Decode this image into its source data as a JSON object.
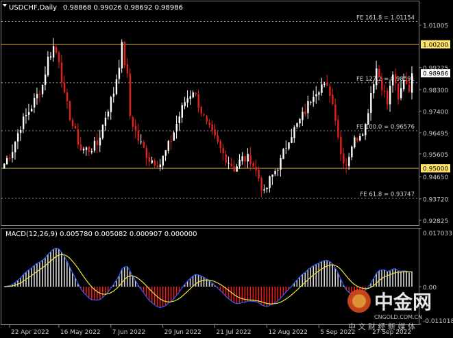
{
  "header": {
    "symbol": "USDCHF,Daily",
    "ohlc": "0.98868 0.99026 0.98692 0.98986"
  },
  "macd_header": {
    "label": "MACD(12,26,9) 0.005780 0.005082 0.000907 0.000000"
  },
  "watermark": {
    "logo_text": "中金网",
    "site": "CNGOLD.COM.CN",
    "tagline": "中 文 财 经 新 媒 体"
  },
  "colors": {
    "background": "#000000",
    "grid": "#3a3a3a",
    "axis_text": "#c8c8c8",
    "bull_candle": "#ffffff",
    "bear_candle": "#e8201c",
    "fib_line": "#a0a0a0",
    "horizontal_line": "#e0b84a",
    "macd_line": "#2d5bff",
    "signal_line": "#f2e43a",
    "hist_pos": "#d8d8d8",
    "hist_neg": "#e8201c",
    "current_price_bg": "#ffffff"
  },
  "chart_data": [
    {
      "type": "candlestick",
      "title": "USDCHF,Daily",
      "ylim": [
        0.9262,
        1.02
      ],
      "price_ticks": [
        "1.01005",
        "0.99225",
        "0.98300",
        "0.97400",
        "0.96495",
        "0.95605",
        "0.94650",
        "0.93720",
        "0.92825"
      ],
      "x_ticks": [
        "22 Apr 2022",
        "16 May 2022",
        "7 Jun 2022",
        "29 Jun 2022",
        "21 Jul 2022",
        "12 Aug 2022",
        "5 Sep 2022",
        "27 Sep 2022"
      ],
      "fibonacci_levels": [
        {
          "label": "FE 161.8 = 1.01154",
          "value": 1.01154
        },
        {
          "label": "FE 127.2 = 0.98591",
          "value": 0.98591
        },
        {
          "label": "FE 100.0 = 0.96576",
          "value": 0.96576
        },
        {
          "label": "FE 61.8 = 0.93747",
          "value": 0.93747
        }
      ],
      "horizontal_lines": [
        {
          "label": "1.00200",
          "value": 1.002
        },
        {
          "label": "0.95000",
          "value": 0.95
        }
      ],
      "current_price": {
        "label": "0.98986",
        "value": 0.98986
      },
      "anchors": [
        [
          0,
          0.952
        ],
        [
          3,
          0.958
        ],
        [
          6,
          0.968
        ],
        [
          10,
          0.976
        ],
        [
          14,
          0.985
        ],
        [
          16,
          0.996
        ],
        [
          18,
          1.001
        ],
        [
          20,
          0.996
        ],
        [
          22,
          0.98
        ],
        [
          25,
          0.968
        ],
        [
          28,
          0.958
        ],
        [
          31,
          0.958
        ],
        [
          34,
          0.96
        ],
        [
          37,
          0.972
        ],
        [
          40,
          0.982
        ],
        [
          42,
          0.994
        ],
        [
          43,
          1.001
        ],
        [
          45,
          0.988
        ],
        [
          46,
          0.972
        ],
        [
          49,
          0.962
        ],
        [
          53,
          0.954
        ],
        [
          57,
          0.952
        ],
        [
          61,
          0.962
        ],
        [
          64,
          0.972
        ],
        [
          66,
          0.978
        ],
        [
          69,
          0.983
        ],
        [
          71,
          0.977
        ],
        [
          74,
          0.968
        ],
        [
          77,
          0.962
        ],
        [
          80,
          0.956
        ],
        [
          84,
          0.95
        ],
        [
          87,
          0.954
        ],
        [
          90,
          0.954
        ],
        [
          93,
          0.946
        ],
        [
          95,
          0.939
        ],
        [
          97,
          0.945
        ],
        [
          101,
          0.953
        ],
        [
          104,
          0.963
        ],
        [
          107,
          0.968
        ],
        [
          110,
          0.974
        ],
        [
          113,
          0.982
        ],
        [
          116,
          0.985
        ],
        [
          119,
          0.982
        ],
        [
          121,
          0.972
        ],
        [
          123,
          0.956
        ],
        [
          125,
          0.952
        ],
        [
          127,
          0.96
        ],
        [
          130,
          0.965
        ],
        [
          132,
          0.968
        ],
        [
          134,
          0.982
        ],
        [
          136,
          0.992
        ],
        [
          138,
          0.985
        ],
        [
          140,
          0.977
        ],
        [
          142,
          0.99
        ],
        [
          144,
          0.978
        ],
        [
          146,
          0.988
        ],
        [
          148,
          0.984
        ],
        [
          149,
          0.98986
        ]
      ],
      "macd_ylim": [
        -0.011018,
        0.017033
      ],
      "macd_ticks": [
        "0.017033",
        "0.00",
        "-0.011018"
      ]
    }
  ]
}
